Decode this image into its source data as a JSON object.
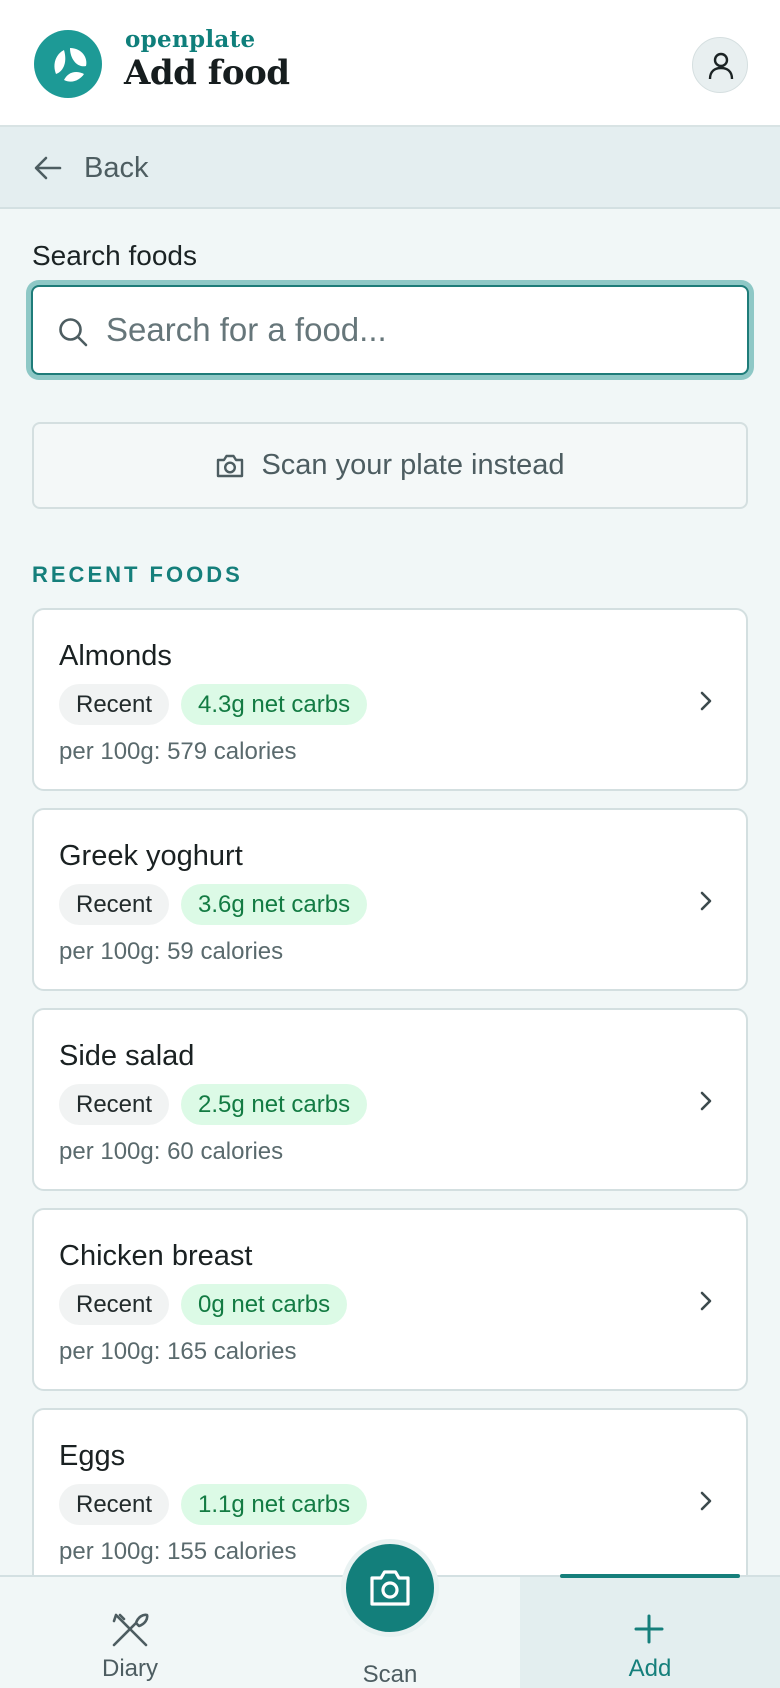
{
  "header": {
    "brand": "openplate",
    "title": "Add food",
    "logo_icon": "leaf-logo-icon",
    "profile_icon": "user-icon"
  },
  "nav": {
    "back_label": "Back"
  },
  "search": {
    "label": "Search foods",
    "placeholder": "Search for a food...",
    "value": ""
  },
  "scan_button": {
    "label": "Scan your plate instead",
    "icon": "camera-icon"
  },
  "recent": {
    "title": "RECENT FOODS",
    "items": [
      {
        "name": "Almonds",
        "badge": "Recent",
        "carbs": "4.3g net carbs",
        "calories": "per 100g: 579 calories"
      },
      {
        "name": "Greek yoghurt",
        "badge": "Recent",
        "carbs": "3.6g net carbs",
        "calories": "per 100g: 59 calories"
      },
      {
        "name": "Side salad",
        "badge": "Recent",
        "carbs": "2.5g net carbs",
        "calories": "per 100g: 60 calories"
      },
      {
        "name": "Chicken breast",
        "badge": "Recent",
        "carbs": "0g net carbs",
        "calories": "per 100g: 165 calories"
      },
      {
        "name": "Eggs",
        "badge": "Recent",
        "carbs": "1.1g net carbs",
        "calories": "per 100g: 155 calories"
      }
    ]
  },
  "tabbar": {
    "diary": "Diary",
    "scan": "Scan",
    "add": "Add",
    "active": "Add"
  },
  "colors": {
    "brand": "#1d9a96",
    "accent": "#157f7b",
    "carbs_chip_bg": "#dcfae6",
    "carbs_chip_text": "#137b43"
  }
}
